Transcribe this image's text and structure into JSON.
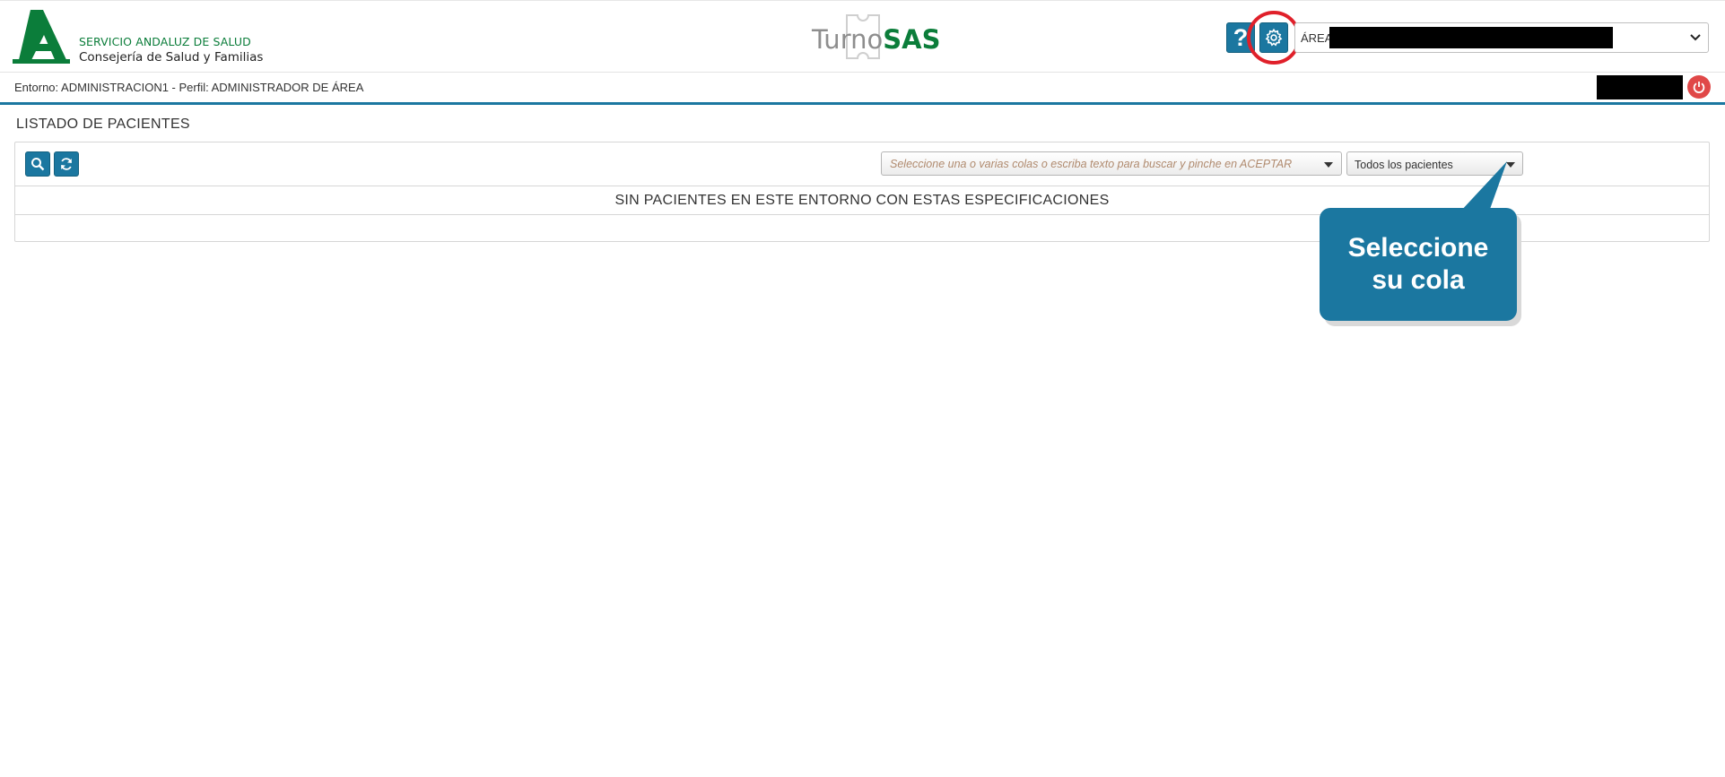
{
  "header": {
    "org_line_1": "SERVICIO ANDALUZ DE SALUD",
    "org_line_2": "Consejería de Salud y Familias",
    "brand_turno": "Turno",
    "brand_sas": "SAS",
    "help_label": "?",
    "area_select_value": "ÁREA"
  },
  "subbar": {
    "environment_text": "Entorno: ADMINISTRACION1 - Perfil: ADMINISTRADOR DE ÁREA"
  },
  "main": {
    "title": "LISTADO DE PACIENTES",
    "queue_placeholder": "Seleccione una o varias colas o escriba texto para buscar y pinche en ACEPTAR",
    "patients_filter_value": "Todos los pacientes",
    "empty_message": "SIN PACIENTES EN ESTE ENTORNO CON ESTAS ESPECIFICACIONES"
  },
  "callout": {
    "line_1": "Seleccione",
    "line_2": "su cola"
  },
  "icons": {
    "help": "question-icon",
    "settings": "gear-icon",
    "search": "search-icon",
    "refresh": "refresh-icon",
    "logout": "power-icon"
  },
  "colors": {
    "primary": "#1b77a0",
    "brand_green": "#0b7d3a",
    "highlight_red": "#e0202a",
    "logout_red": "#e04848"
  }
}
